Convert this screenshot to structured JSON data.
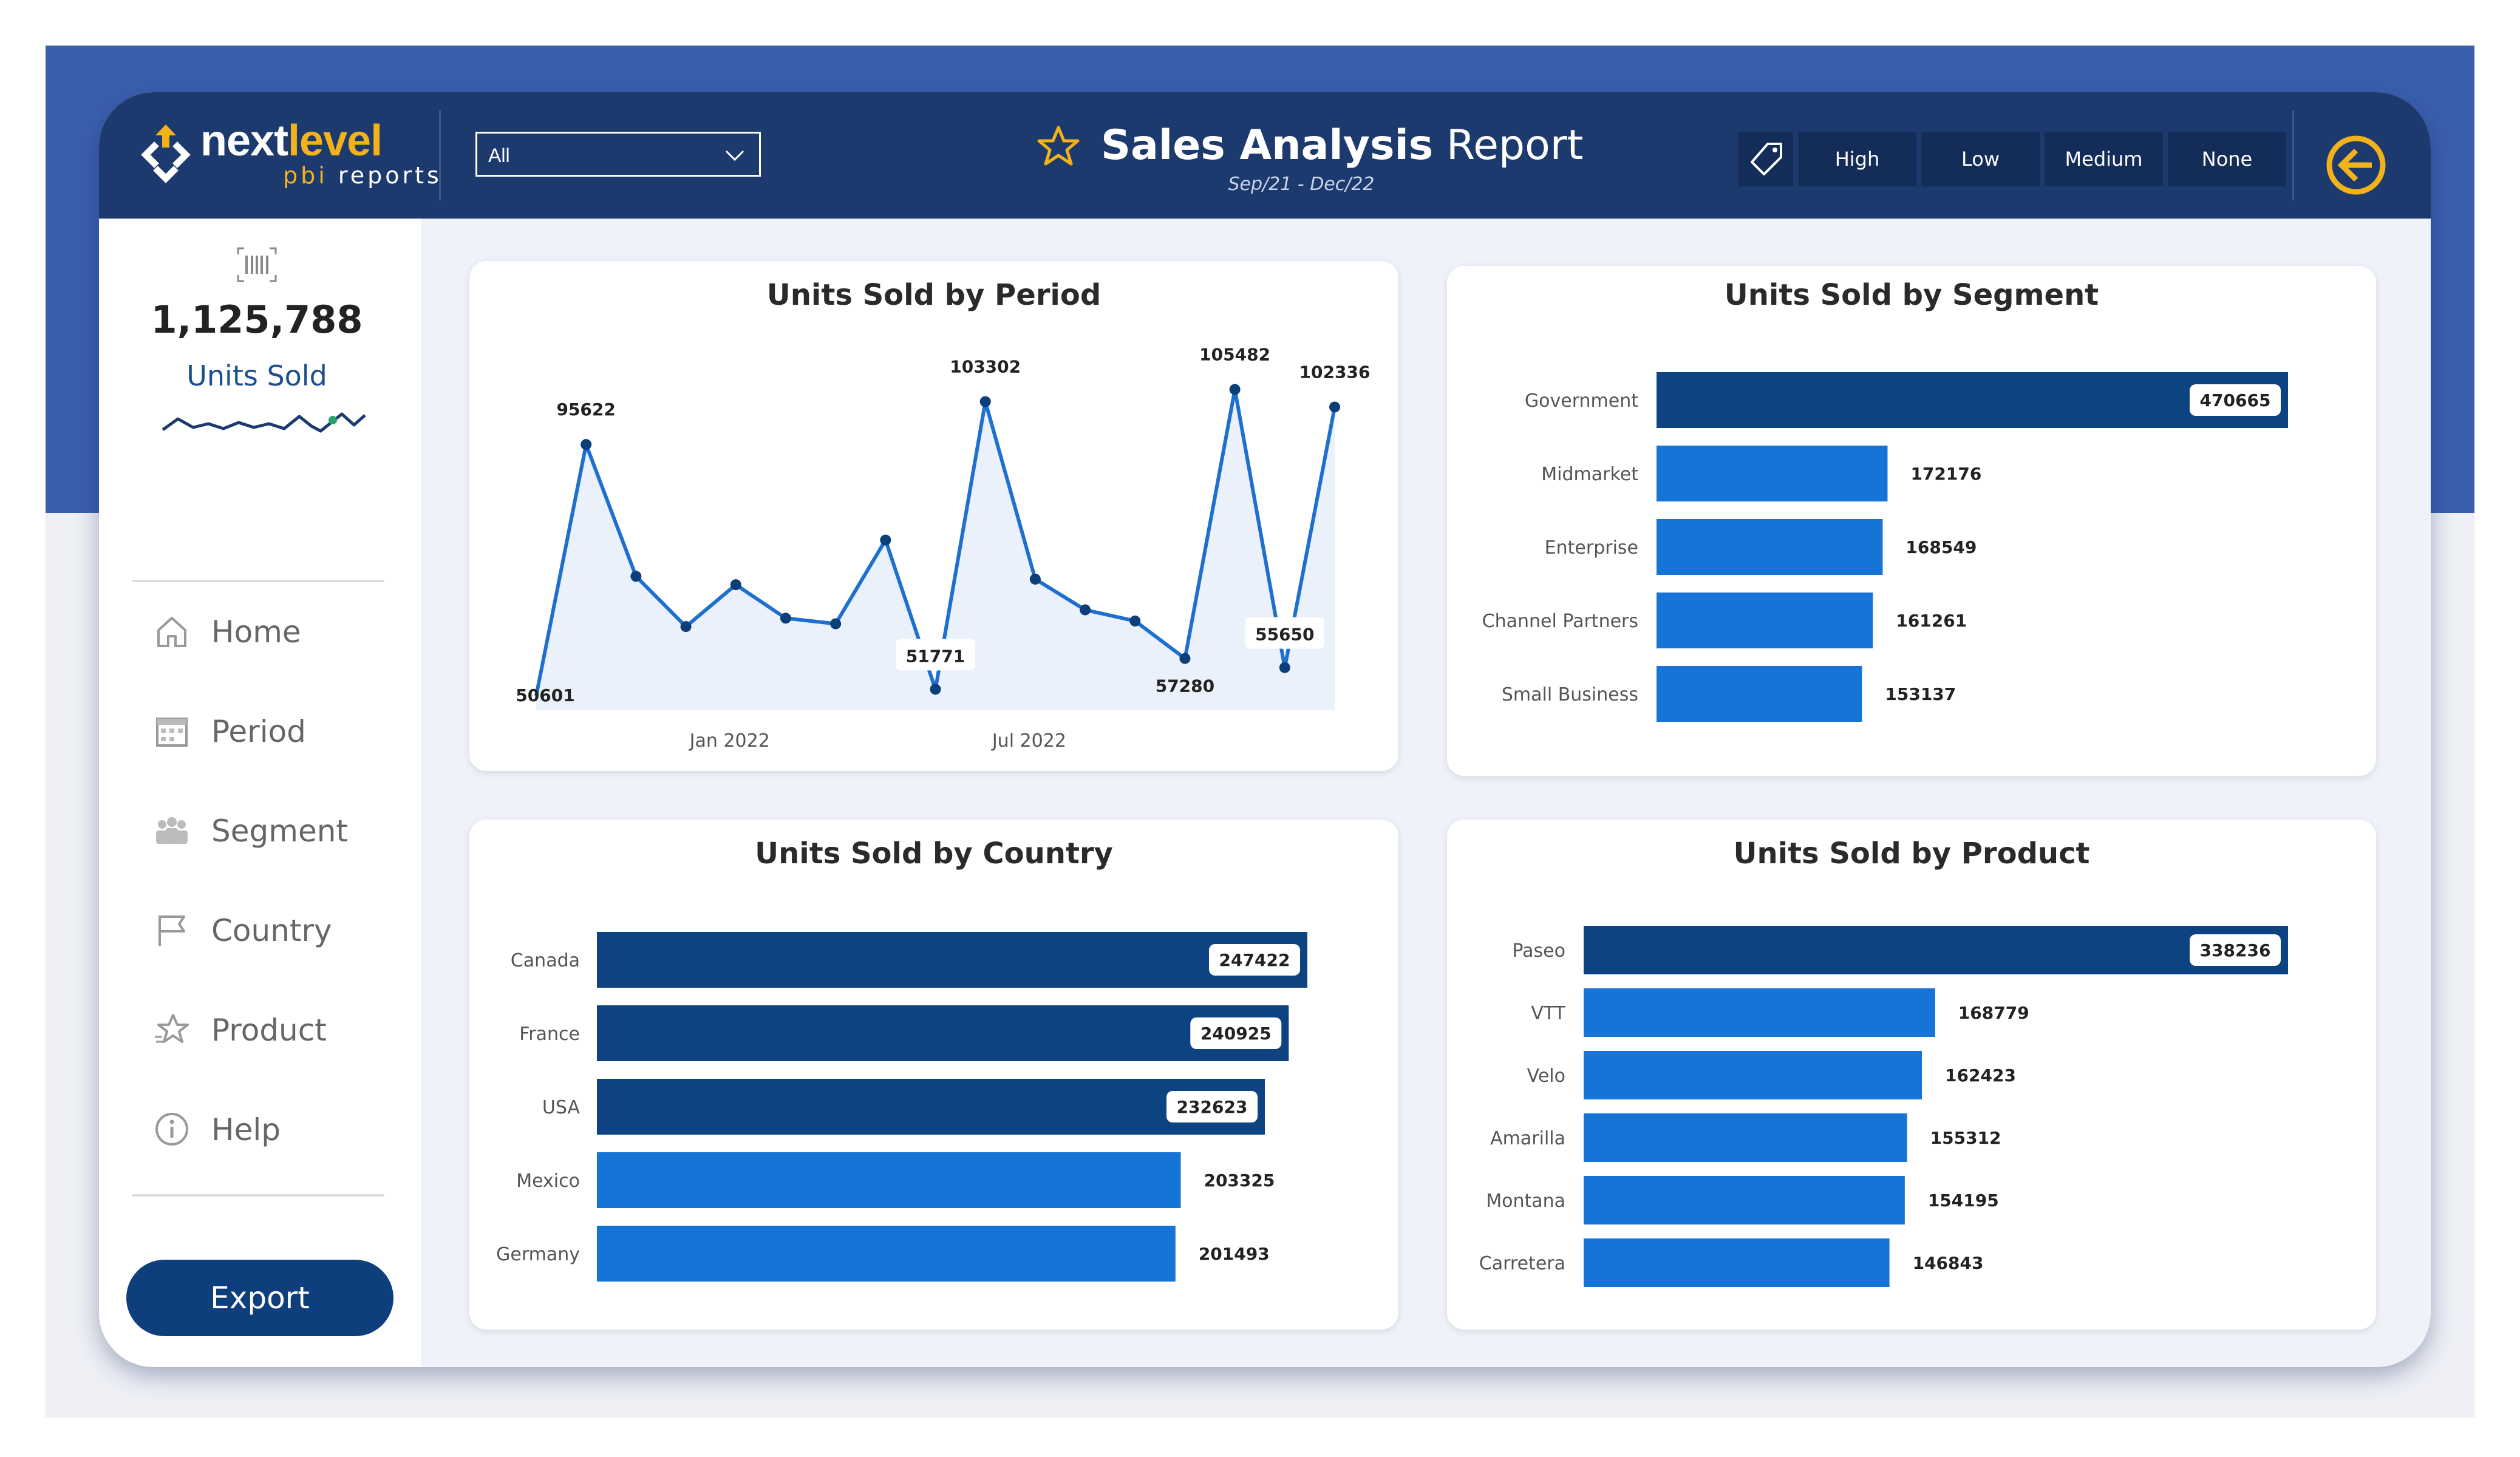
{
  "brand": {
    "name_part1": "next",
    "name_part2": "level",
    "sub_part1": "pbi",
    "sub_part2": "reports"
  },
  "filter": {
    "selected": "All"
  },
  "header": {
    "title_bold": "Sales Analysis",
    "title_regular": "Report",
    "subtitle": "Sep/21 - Dec/22"
  },
  "priority_filters": [
    "High",
    "Low",
    "Medium",
    "None"
  ],
  "kpi": {
    "value": "1,125,788",
    "label": "Units Sold"
  },
  "nav": [
    {
      "label": "Home",
      "icon": "home-icon"
    },
    {
      "label": "Period",
      "icon": "calendar-icon"
    },
    {
      "label": "Segment",
      "icon": "segment-people-icon"
    },
    {
      "label": "Country",
      "icon": "flag-icon"
    },
    {
      "label": "Product",
      "icon": "star-product-icon"
    },
    {
      "label": "Help",
      "icon": "info-icon"
    }
  ],
  "export_label": "Export",
  "colors": {
    "header": "#1d3a6e",
    "accent": "#f2b21a",
    "bar_dark": "#0c4380",
    "bar_light": "#1574d6",
    "line": "#1f6fd0"
  },
  "chart_data": [
    {
      "id": "period",
      "type": "line",
      "title": "Units Sold by Period",
      "x_tick_labels": [
        "Jan 2022",
        "Jul 2022"
      ],
      "values": [
        50601,
        95622,
        72000,
        63000,
        70500,
        64500,
        63500,
        78500,
        51771,
        103302,
        71500,
        66000,
        64000,
        57280,
        105482,
        55650,
        102336
      ],
      "labeled": {
        "0": "50601",
        "1": "95622",
        "8": "51771",
        "9": "103302",
        "13": "57280",
        "14": "105482",
        "15": "55650",
        "16": "102336"
      },
      "ylim": [
        48000,
        110000
      ]
    },
    {
      "id": "segment",
      "type": "bar",
      "title": "Units Sold by Segment",
      "categories": [
        "Government",
        "Midmarket",
        "Enterprise",
        "Channel Partners",
        "Small Business"
      ],
      "values": [
        470665,
        172176,
        168549,
        161261,
        153137
      ],
      "xlim": [
        0,
        470665
      ]
    },
    {
      "id": "country",
      "type": "bar",
      "title": "Units Sold by Country",
      "categories": [
        "Canada",
        "France",
        "USA",
        "Mexico",
        "Germany"
      ],
      "values": [
        247422,
        240925,
        232623,
        203325,
        201493
      ],
      "xlim": [
        0,
        247422
      ]
    },
    {
      "id": "product",
      "type": "bar",
      "title": "Units Sold by Product",
      "categories": [
        "Paseo",
        "VTT",
        "Velo",
        "Amarilla",
        "Montana",
        "Carretera"
      ],
      "values": [
        338236,
        168779,
        162423,
        155312,
        154195,
        146843
      ],
      "xlim": [
        0,
        338236
      ]
    }
  ]
}
